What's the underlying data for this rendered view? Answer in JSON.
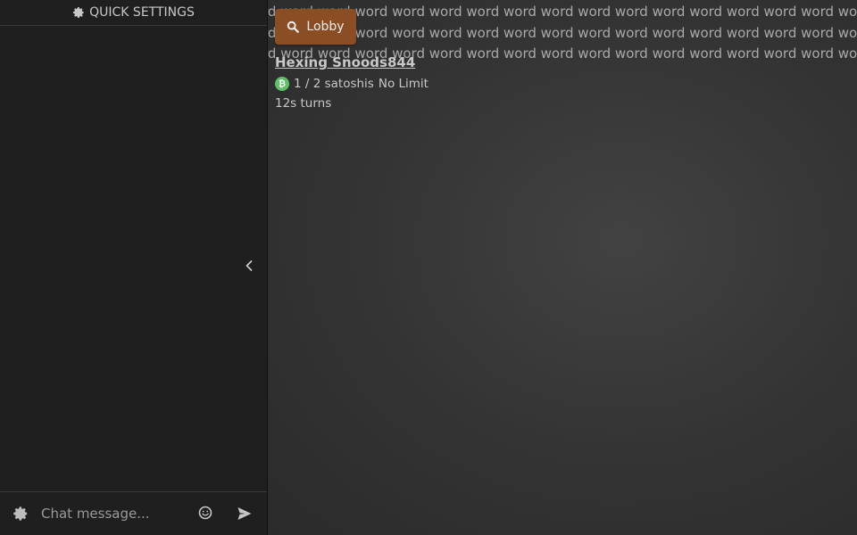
{
  "sidebar": {
    "header_label": "QUICK SETTINGS",
    "header_icon": "gear-icon",
    "collapse_icon": "chevron-left-icon",
    "chat": {
      "placeholder": "Chat message...",
      "settings_icon": "gear-icon",
      "emoji_icon": "emoji-smile-icon",
      "send_icon": "send-icon"
    }
  },
  "main": {
    "word_lines": [
      "rd word word word word word word word word word word word word word word word word word",
      "rd word word word word word word word word word word word word word word word word word",
      "rd word word word word word word word word word word word word word word word word word"
    ],
    "lobby_button": {
      "label": "Lobby",
      "icon": "search-icon",
      "color": "#8a4d24"
    },
    "table": {
      "name": "Hexing Snoods844",
      "coin_icon": "bitcoin-coin-icon",
      "coin_color": "#5fbf66",
      "stakes": "1 / 2 satoshis",
      "limit": "No Limit",
      "turns": "12s turns"
    }
  }
}
